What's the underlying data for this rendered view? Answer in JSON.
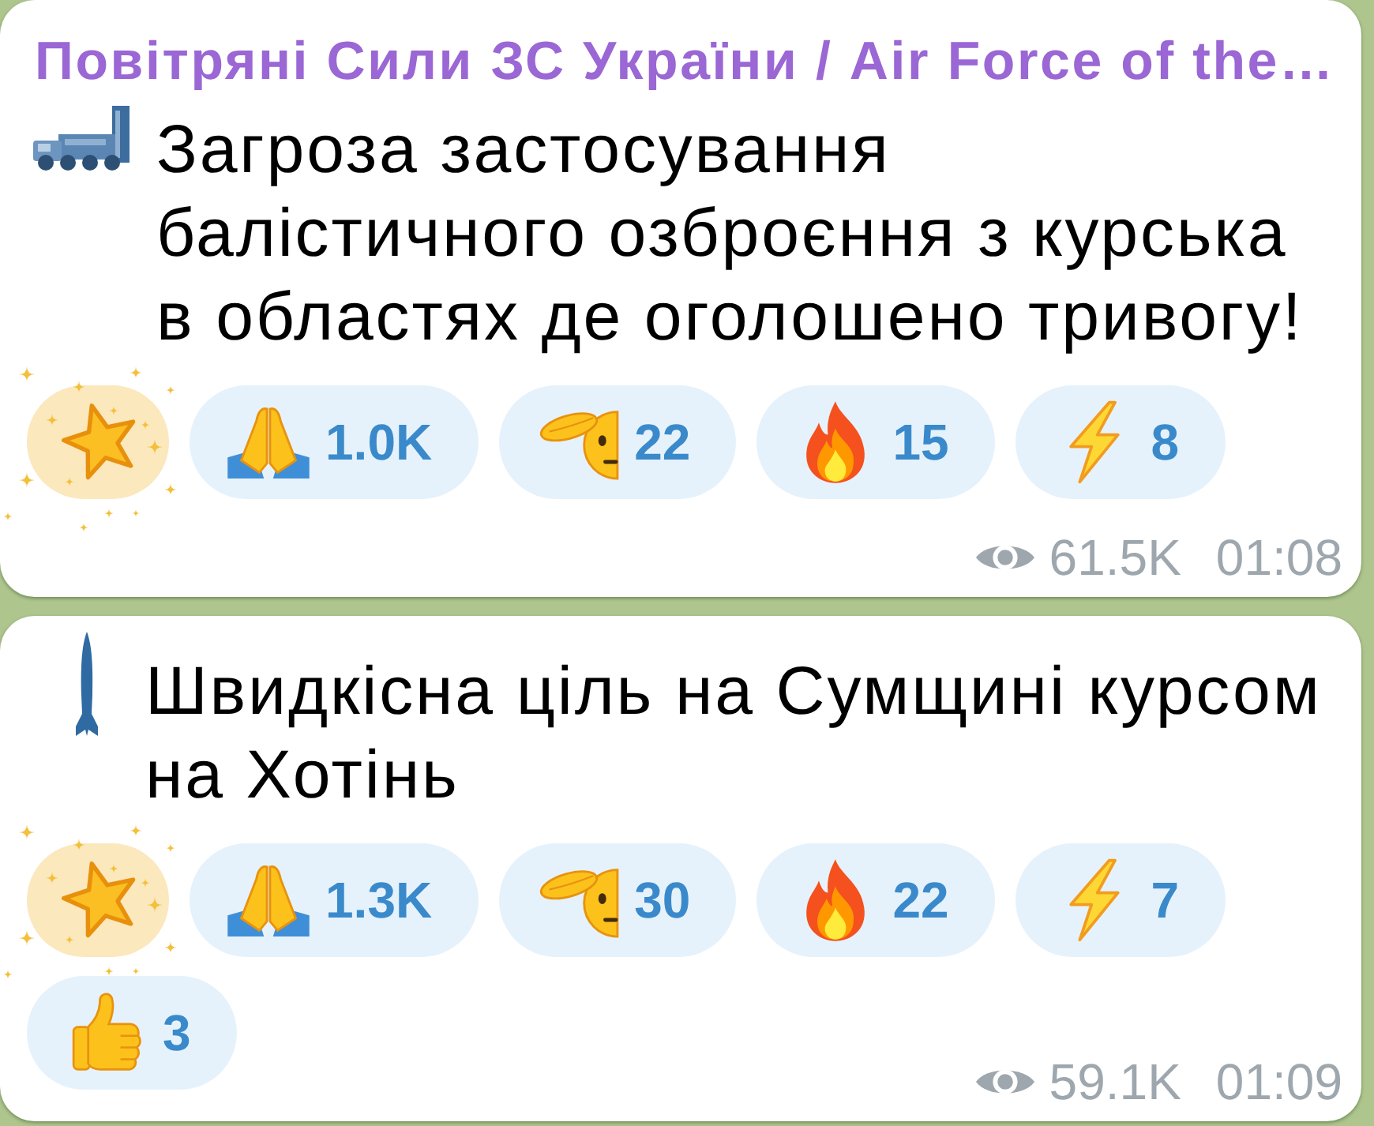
{
  "messages": [
    {
      "author": "Повітряні Сили ЗС України / Air Force of the…",
      "kind": "launcher",
      "text": "Загроза застосування балістичного озброєння з курська в областях де оголошено тривогу!",
      "reactions": [
        {
          "kind": "star",
          "selected": false
        },
        {
          "kind": "pray",
          "count": "1.0K",
          "selected": false
        },
        {
          "kind": "salute",
          "count": "22",
          "selected": false
        },
        {
          "kind": "fire",
          "count": "15",
          "selected": false
        },
        {
          "kind": "zap",
          "count": "8",
          "selected": false
        }
      ],
      "views": "61.5K",
      "time": "01:08"
    },
    {
      "kind": "missile",
      "text": "Швидкісна ціль на Сумщині курсом на Хотінь",
      "reactions": [
        {
          "kind": "star",
          "selected": false
        },
        {
          "kind": "pray",
          "count": "1.3K",
          "selected": false
        },
        {
          "kind": "salute",
          "count": "30",
          "selected": false
        },
        {
          "kind": "fire",
          "count": "22",
          "selected": false
        },
        {
          "kind": "zap",
          "count": "7",
          "selected": false
        },
        {
          "kind": "thumbsup",
          "count": "3",
          "selected": false
        }
      ],
      "views": "59.1K",
      "time": "01:09"
    }
  ]
}
